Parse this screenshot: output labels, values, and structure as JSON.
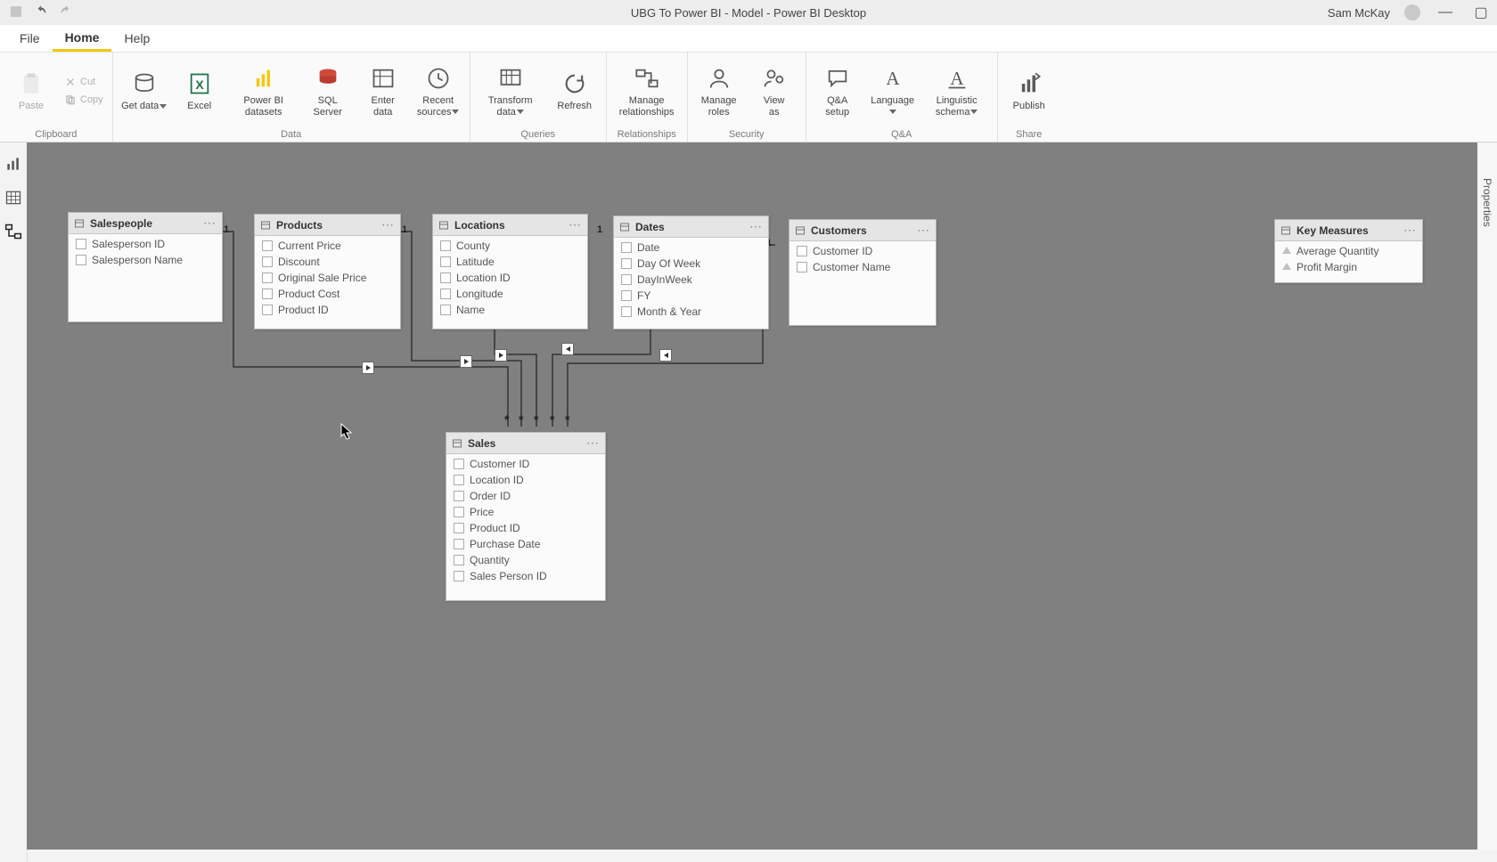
{
  "titlebar": {
    "title": "UBG To Power BI - Model - Power BI Desktop",
    "user": "Sam McKay"
  },
  "menu": {
    "file": "File",
    "home": "Home",
    "help": "Help"
  },
  "ribbon": {
    "clipboard": {
      "label": "Clipboard",
      "paste": "Paste",
      "cut": "Cut",
      "copy": "Copy"
    },
    "data": {
      "label": "Data",
      "get_data": "Get\ndata",
      "excel": "Excel",
      "pbi_datasets": "Power BI\ndatasets",
      "sql": "SQL\nServer",
      "enter": "Enter\ndata",
      "recent": "Recent\nsources"
    },
    "queries": {
      "label": "Queries",
      "transform": "Transform\ndata",
      "refresh": "Refresh"
    },
    "relationships": {
      "label": "Relationships",
      "manage": "Manage\nrelationships"
    },
    "security": {
      "label": "Security",
      "manage_roles": "Manage\nroles",
      "view_as": "View\nas"
    },
    "qa": {
      "label": "Q&A",
      "setup": "Q&A\nsetup",
      "language": "Language",
      "schema": "Linguistic\nschema"
    },
    "share": {
      "label": "Share",
      "publish": "Publish"
    }
  },
  "right_pane": {
    "label": "Properties"
  },
  "tables": {
    "salespeople": {
      "title": "Salespeople",
      "fields": [
        "Salesperson ID",
        "Salesperson Name"
      ]
    },
    "products": {
      "title": "Products",
      "fields": [
        "Current Price",
        "Discount",
        "Original Sale Price",
        "Product Cost",
        "Product ID"
      ]
    },
    "locations": {
      "title": "Locations",
      "fields": [
        "County",
        "Latitude",
        "Location ID",
        "Longitude",
        "Name"
      ]
    },
    "dates": {
      "title": "Dates",
      "fields": [
        "Date",
        "Day Of Week",
        "DayInWeek",
        "FY",
        "Month & Year"
      ]
    },
    "customers": {
      "title": "Customers",
      "fields": [
        "Customer ID",
        "Customer Name"
      ]
    },
    "keymeasures": {
      "title": "Key Measures",
      "fields": [
        "Average Quantity",
        "Profit Margin"
      ]
    },
    "sales": {
      "title": "Sales",
      "fields": [
        "Customer ID",
        "Location ID",
        "Order ID",
        "Price",
        "Product ID",
        "Purchase Date",
        "Quantity",
        "Sales Person ID"
      ]
    }
  }
}
